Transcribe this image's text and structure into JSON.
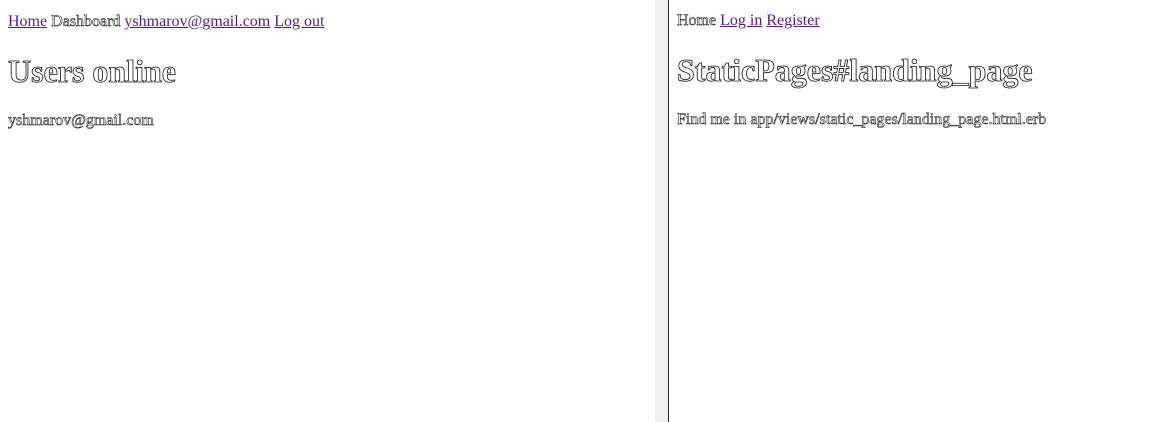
{
  "left_pane": {
    "nav": {
      "home": "Home",
      "dashboard": "Dashboard",
      "user_email": "yshmarov@gmail.com",
      "logout": "Log out"
    },
    "title": "Users online",
    "online_users": [
      "yshmarov@gmail.com"
    ]
  },
  "right_pane": {
    "nav": {
      "home": "Home",
      "login": "Log in",
      "register": "Register"
    },
    "title": "StaticPages#landing_page",
    "body": "Find me in app/views/static_pages/landing_page.html.erb"
  },
  "colors": {
    "link_visited": "#551a8b",
    "divider": "#2b2b2b",
    "gutter": "#f0f0f0"
  }
}
